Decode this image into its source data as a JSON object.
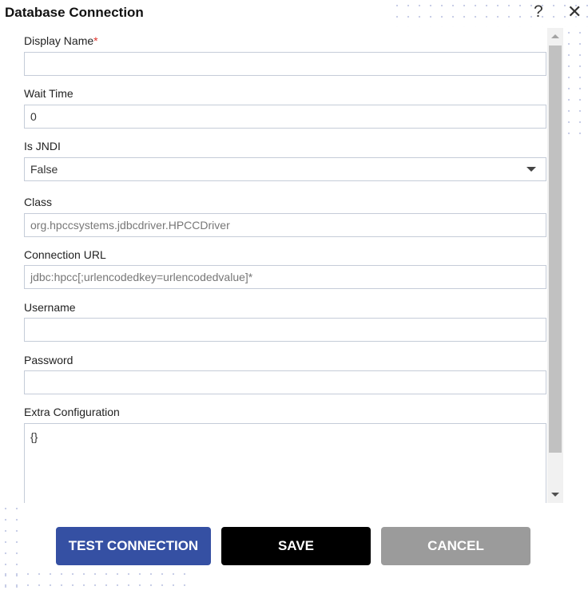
{
  "dialog": {
    "title": "Database Connection",
    "help_icon": "question-icon",
    "close_icon": "close-icon"
  },
  "form": {
    "display_name": {
      "label": "Display Name",
      "required_mark": "*",
      "value": ""
    },
    "wait_time": {
      "label": "Wait Time",
      "value": "0"
    },
    "is_jndi": {
      "label": "Is JNDI",
      "value": "False"
    },
    "class": {
      "label": "Class",
      "placeholder": "org.hpccsystems.jdbcdriver.HPCCDriver"
    },
    "connection_url": {
      "label": "Connection URL",
      "placeholder": "jdbc:hpcc[;urlencodedkey=urlencodedvalue]*"
    },
    "username": {
      "label": "Username",
      "value": ""
    },
    "password": {
      "label": "Password",
      "value": ""
    },
    "extra_configuration": {
      "label": "Extra Configuration",
      "value": "{}"
    }
  },
  "buttons": {
    "test": "TEST CONNECTION",
    "save": "SAVE",
    "cancel": "CANCEL"
  },
  "colors": {
    "test": "#3550a3",
    "save": "#000000",
    "cancel": "#9b9b9b",
    "required": "#e0342c"
  }
}
